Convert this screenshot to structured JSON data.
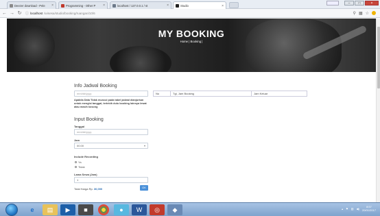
{
  "browser": {
    "tabs": [
      {
        "title": "Deezer download - Pele",
        "active": false,
        "color": "#8a8a8a"
      },
      {
        "title": "Programming - Other P",
        "active": false,
        "color": "#c0392b"
      },
      {
        "title": "localhost / 127.0.0.1 / st",
        "active": false,
        "color": "#6d7a8a"
      },
      {
        "title": "Studio",
        "active": true,
        "color": "#222222"
      }
    ],
    "url_host": "localhost",
    "url_path": "/wisesa/studio/booking/ruangan/10/6"
  },
  "hero": {
    "title": "MY BOOKING",
    "breadcrumb": "Home | Booking |"
  },
  "info": {
    "title": "Info Jadwal Booking",
    "date_placeholder": "mm/dd/yyyy",
    "help_text": "Apabila Data Tidak muncul pada tabel jadwal dianjurkan untuk mengisi tanggal, terlebih dulu booking lainnya lewat atau masih kosong",
    "table_headers": [
      "No",
      "Tgl, Jam Booking",
      "Jam Keluar"
    ]
  },
  "input": {
    "title": "Input Booking",
    "tanggal_label": "Tanggal",
    "tanggal_placeholder": "mm/dd/yyyy",
    "jam_label": "Jam",
    "jam_value": "00.00",
    "recording_label": "Include Recording",
    "option_yes": "Ya",
    "option_no": "Tidak",
    "lama_label": "Lama Sewa (Jam)",
    "lama_value": "1",
    "total_label": "Total Harga Rp.",
    "total_value": "30,000",
    "ok_label": "OK"
  },
  "taskbar": {
    "time": "8:57",
    "date": "20/01/2017"
  }
}
